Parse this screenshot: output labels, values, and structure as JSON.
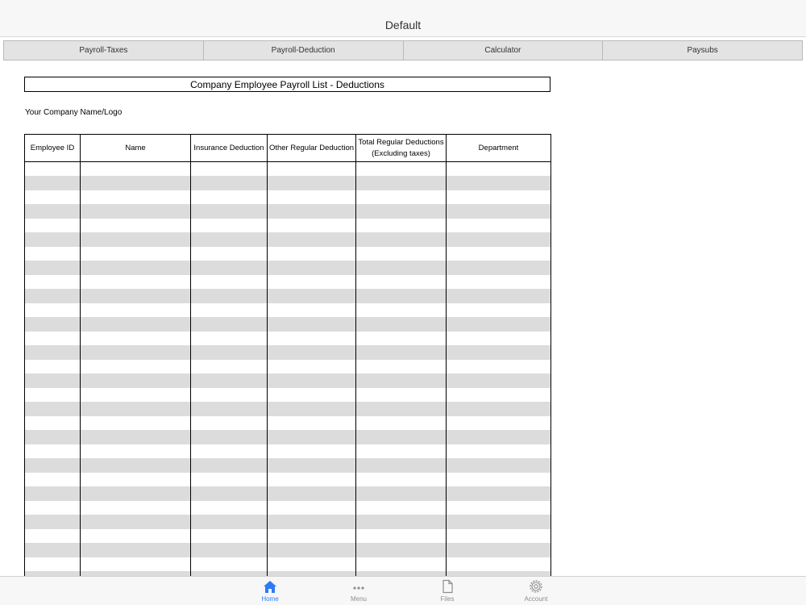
{
  "nav": {
    "title": "Default"
  },
  "sheet_tabs": [
    {
      "label": "Payroll-Taxes"
    },
    {
      "label": "Payroll-Deduction"
    },
    {
      "label": "Calculator"
    },
    {
      "label": "Paysubs"
    }
  ],
  "report": {
    "title": "Company Employee Payroll List - Deductions",
    "company_label": "Your Company Name/Logo",
    "columns": [
      {
        "label": "Employee ID"
      },
      {
        "label": "Name"
      },
      {
        "label": "Insurance Deduction"
      },
      {
        "label": "Other Regular Deduction"
      },
      {
        "label": "Total Regular Deductions\n(Excluding taxes)"
      },
      {
        "label": "Department"
      }
    ]
  },
  "tab_bar": {
    "active_color": "#2f7bf5",
    "items": [
      {
        "label": "Home",
        "icon": "home-icon"
      },
      {
        "label": "Menu",
        "icon": "more-icon"
      },
      {
        "label": "Files",
        "icon": "file-icon"
      },
      {
        "label": "Account",
        "icon": "gear-icon"
      }
    ]
  }
}
